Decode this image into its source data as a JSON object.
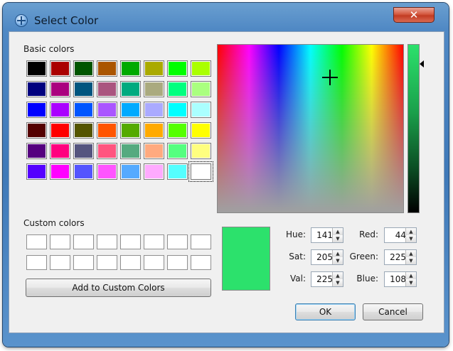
{
  "window": {
    "title": "Select Color",
    "close_glyph": "✕",
    "icon": "color-dialog-icon"
  },
  "basic_colors": {
    "label": "Basic colors",
    "rows": [
      [
        "#000000",
        "#aa0000",
        "#005500",
        "#aa5500",
        "#00aa00",
        "#aaaa00",
        "#00ff00",
        "#aaff00"
      ],
      [
        "#00007f",
        "#aa007f",
        "#00557f",
        "#aa557f",
        "#00aa7f",
        "#aaaa7f",
        "#00ff7f",
        "#aaff7f"
      ],
      [
        "#0000ff",
        "#aa00ff",
        "#0055ff",
        "#aa55ff",
        "#00aaff",
        "#aaaaff",
        "#00ffff",
        "#aaffff"
      ],
      [
        "#550000",
        "#ff0000",
        "#555500",
        "#ff5500",
        "#55aa00",
        "#ffaa00",
        "#55ff00",
        "#ffff00"
      ],
      [
        "#55007f",
        "#ff007f",
        "#55557f",
        "#ff557f",
        "#55aa7f",
        "#ffaa7f",
        "#55ff7f",
        "#ffff7f"
      ],
      [
        "#5500ff",
        "#ff00ff",
        "#5555ff",
        "#ff55ff",
        "#55aaff",
        "#ffaaff",
        "#55ffff",
        "#ffffff"
      ]
    ],
    "selected": [
      5,
      7
    ]
  },
  "custom_colors": {
    "label": "Custom colors",
    "rows": 2,
    "cols": 8,
    "add_button": "Add to Custom Colors"
  },
  "current": {
    "color": "#2ce16c",
    "hue_label": "Hue:",
    "hue": "141",
    "sat_label": "Sat:",
    "sat": "205",
    "val_label": "Val:",
    "val": "225",
    "red_label": "Red:",
    "red": "44",
    "green_label": "Green:",
    "green": "225",
    "blue_label": "Blue:",
    "blue": "108"
  },
  "buttons": {
    "ok": "OK",
    "cancel": "Cancel"
  }
}
